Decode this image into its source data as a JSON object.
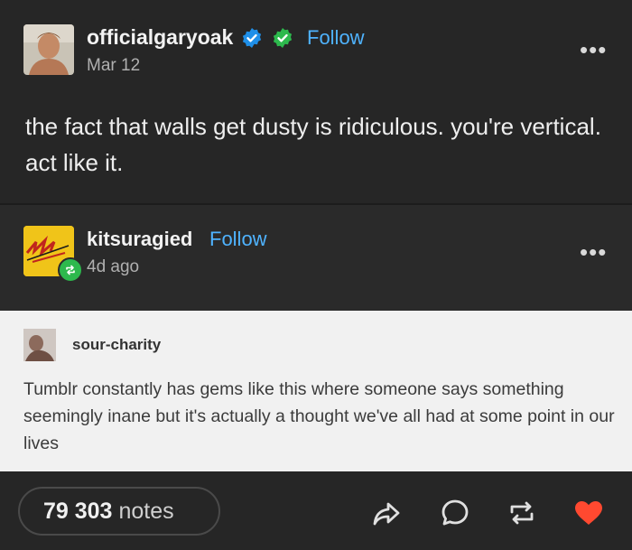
{
  "post": {
    "author": "officialgaryoak",
    "follow_label": "Follow",
    "date": "Mar 12",
    "more_label": "•••",
    "text": "the fact that walls get dusty is ridiculous. you're vertical. act like it."
  },
  "reblog": {
    "author": "kitsuragied",
    "follow_label": "Follow",
    "time": "4d ago",
    "more_label": "•••"
  },
  "embedded": {
    "author": "sour-charity",
    "text": "Tumblr constantly has gems like this where someone says something seemingly inane but it's actually a thought we've all had at some point in our lives"
  },
  "footer": {
    "notes_count": "79 303",
    "notes_label": "notes"
  },
  "colors": {
    "follow": "#4fb3ff",
    "verified_blue": "#1f8fe8",
    "verified_green": "#2db94d",
    "like": "#ff4930"
  },
  "icons": [
    "share-icon",
    "reply-icon",
    "reblog-icon",
    "heart-icon",
    "more-icon",
    "verified-badge-icon",
    "reblog-badge-icon"
  ]
}
